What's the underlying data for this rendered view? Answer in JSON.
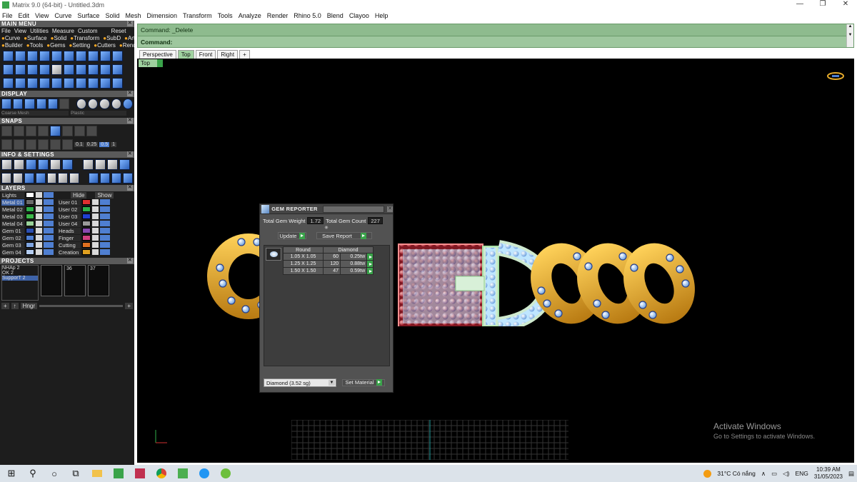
{
  "window": {
    "title": "Matrix 9.0 (64-bit) - Untitled.3dm",
    "controls": [
      "—",
      "❐",
      "✕"
    ]
  },
  "menubar": [
    "File",
    "Edit",
    "View",
    "Curve",
    "Surface",
    "Solid",
    "Mesh",
    "Dimension",
    "Transform",
    "Tools",
    "Analyze",
    "Render",
    "Rhino 5.0",
    "Blend",
    "Clayoo",
    "Help"
  ],
  "left_panel": {
    "main_menu": {
      "title": "MAIN MENU",
      "row1": [
        "File",
        "View",
        "Utilities",
        "Measure",
        "Custom",
        "Reset"
      ],
      "row2": [
        "Curve",
        "Surface",
        "Solid",
        "Transform",
        "SubD",
        "Art"
      ],
      "row3": [
        "Builder",
        "Tools",
        "Gems",
        "Setting",
        "Cutters",
        "Render"
      ]
    },
    "display": {
      "title": "DISPLAY",
      "left_label": "Coarse Mesh",
      "right_label": "Plastic"
    },
    "snaps": {
      "title": "SNAPS",
      "values": [
        "0.1",
        "0.25",
        "0.5",
        "1"
      ]
    },
    "info": {
      "title": "INFO & SETTINGS"
    },
    "layers": {
      "title": "LAYERS",
      "lights": "Lights",
      "hide": "Hide",
      "show": "Show",
      "left": [
        {
          "name": "Metal 01",
          "color": "#6a6a6a",
          "selected": true
        },
        {
          "name": "Metal 02",
          "color": "#2fb04a"
        },
        {
          "name": "Metal 03",
          "color": "#3db84a"
        },
        {
          "name": "Metal 04",
          "color": "#9ad39a"
        },
        {
          "name": "Gem 01",
          "color": "#2c4fb0"
        },
        {
          "name": "Gem 02",
          "color": "#4f7fd1"
        },
        {
          "name": "Gem 03",
          "color": "#7fa5e0"
        },
        {
          "name": "Gem 04",
          "color": "#b5cdf0"
        }
      ],
      "right": [
        {
          "name": "User 01",
          "color": "#e03030"
        },
        {
          "name": "User 02",
          "color": "#2fb04a"
        },
        {
          "name": "User 03",
          "color": "#2040d0"
        },
        {
          "name": "User 04",
          "color": "#9a9a9a"
        },
        {
          "name": "Heads",
          "color": "#8a4ab0"
        },
        {
          "name": "Finger",
          "color": "#d04080"
        },
        {
          "name": "Cutting",
          "color": "#e07020"
        },
        {
          "name": "Creation",
          "color": "#e0a020"
        }
      ]
    },
    "projects": {
      "title": "PROJECTS",
      "items": [
        "NHAp 2",
        "OK 2",
        "SupporT 2"
      ],
      "thumbs": [
        "",
        "36",
        "37"
      ],
      "hinge_label": "Hngr"
    }
  },
  "command": {
    "line1": "Command: _Delete",
    "line2": "Command:"
  },
  "viewport_tabs": [
    "Perspective",
    "Top",
    "Front",
    "Right",
    "+"
  ],
  "viewport_label": "Top",
  "gem_reporter": {
    "title": "GEM REPORTER",
    "total_weight_label": "Total Gem Weight",
    "total_weight": "1.72",
    "total_count_label": "Total Gem Count",
    "total_count": "227",
    "update_label": "Update",
    "save_report_label": "Save Report",
    "columns": [
      "Round",
      "Diamond"
    ],
    "rows": [
      {
        "size": "1.05 X 1.05",
        "count": "60",
        "weight": "0.25tw"
      },
      {
        "size": "1.25 X 1.25",
        "count": "120",
        "weight": "0.88tw"
      },
      {
        "size": "1.50 X 1.50",
        "count": "47",
        "weight": "0.59tw"
      }
    ],
    "material": "Diamond     (3.52 sg)",
    "set_material_label": "Set Material"
  },
  "watermark": {
    "line1": "Activate Windows",
    "line2": "Go to Settings to activate Windows."
  },
  "taskbar": {
    "weather": "31°C  Có nắng",
    "lang": "ENG",
    "time": "10:39 AM",
    "date": "31/05/2023",
    "icons": [
      "windows-start-icon",
      "search-icon",
      "cortana-icon",
      "task-view-icon",
      "file-explorer-icon",
      "matrix-icon",
      "app-icon",
      "chrome-icon",
      "app-icon",
      "zalo-icon",
      "app-icon"
    ]
  },
  "colors": {
    "command_bg": "#8ebb8e",
    "viewport_bg": "#000000",
    "accent_green": "#3aa34a",
    "gold": "#e4a92a"
  }
}
